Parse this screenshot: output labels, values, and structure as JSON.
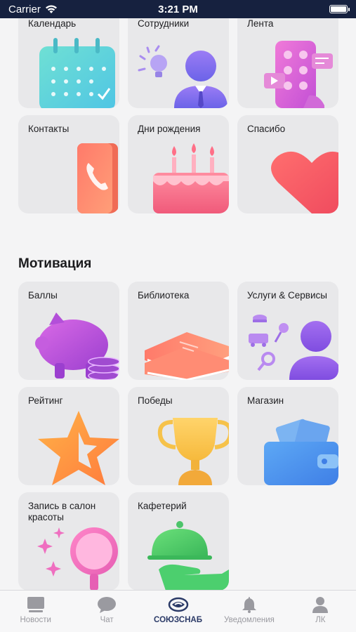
{
  "status_bar": {
    "carrier": "Carrier",
    "time": "3:21 PM"
  },
  "section_motivation": "Мотивация",
  "tiles": {
    "calendar": "Календарь",
    "employees": "Сотрудники",
    "feed": "Лента",
    "contacts": "Контакты",
    "birthdays": "Дни рождения",
    "thanks": "Спасибо",
    "points": "Баллы",
    "library": "Библиотека",
    "services": "Услуги & Сервисы",
    "rating": "Рейтинг",
    "victories": "Победы",
    "shop": "Магазин",
    "beauty": "Запись в салон красоты",
    "cafeteria": "Кафетерий"
  },
  "tabbar": {
    "news": "Новости",
    "chat": "Чат",
    "home": "СОЮЗСНАБ",
    "notifications": "Уведомления",
    "profile": "ЛК"
  },
  "colors": {
    "status_bar": "#16213f",
    "active_tab": "#2b3a67",
    "tile_bg": "#e8e8ea"
  }
}
